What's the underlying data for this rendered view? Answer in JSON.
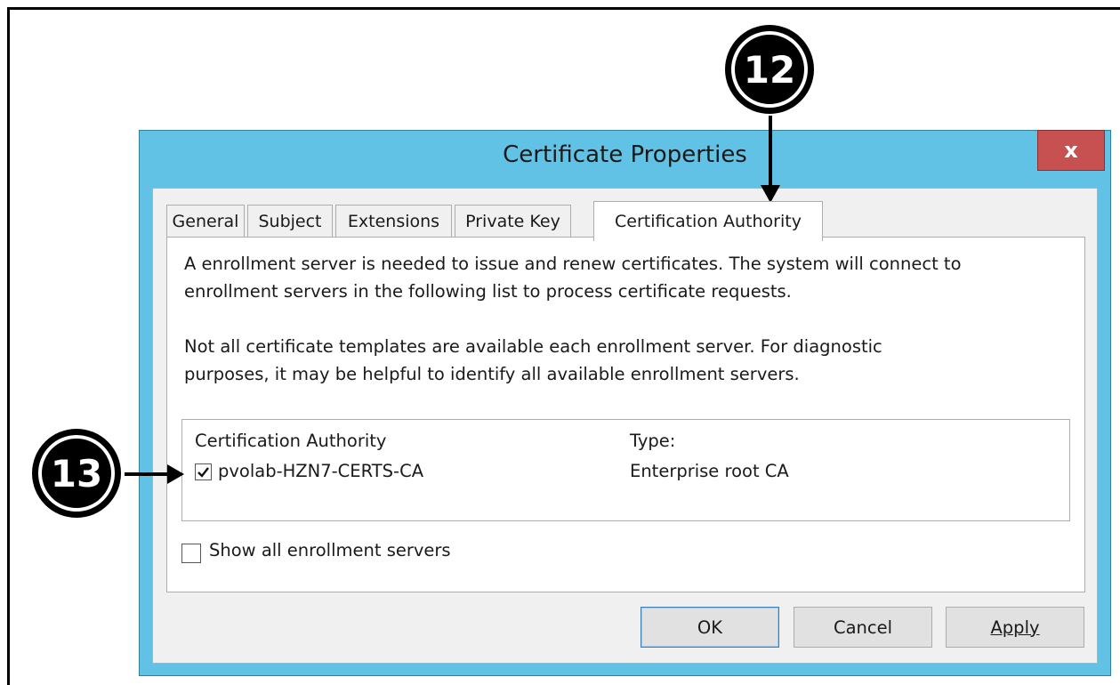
{
  "dialog": {
    "title": "Certificate Properties",
    "close_label": "x"
  },
  "tabs": [
    {
      "label": "General",
      "active": false
    },
    {
      "label": "Subject",
      "active": false
    },
    {
      "label": "Extensions",
      "active": false
    },
    {
      "label": "Private Key",
      "active": false
    },
    {
      "label": "Certification Authority",
      "active": true
    }
  ],
  "panel": {
    "para1_line1": "A enrollment server is needed to issue and renew certificates. The system will connect to",
    "para1_line2": "enrollment servers in the following list to process certificate requests.",
    "para2_line1": "Not all certificate templates are available each enrollment server. For diagnostic",
    "para2_line2": "purposes, it may be helpful to identify all available enrollment servers.",
    "list": {
      "col_ca": "Certification Authority",
      "col_type": "Type:",
      "rows": [
        {
          "name": "pvolab-HZN7-CERTS-CA",
          "type": "Enterprise root CA",
          "checked": true
        }
      ]
    },
    "show_all_label": "Show all enrollment servers",
    "show_all_checked": false
  },
  "buttons": {
    "ok": "OK",
    "cancel": "Cancel",
    "apply": "Apply"
  },
  "callouts": {
    "c12": "12",
    "c13": "13"
  },
  "colors": {
    "title_bar": "#62c2e6",
    "close_button": "#c75050"
  }
}
